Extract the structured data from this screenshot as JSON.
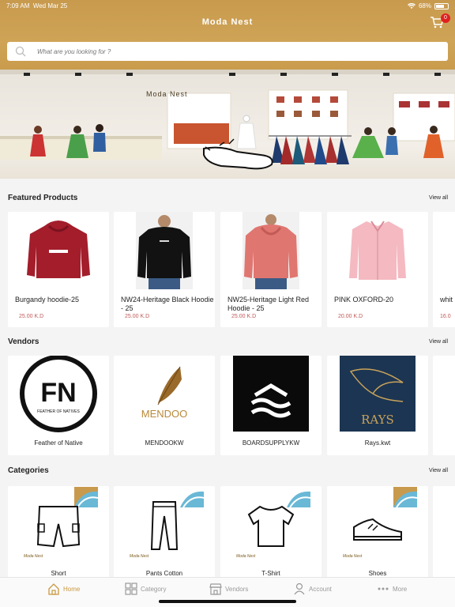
{
  "status_bar": {
    "time": "7:09 AM",
    "date": "Wed Mar 25",
    "battery": "68%",
    "battery_level": 0.68
  },
  "header": {
    "title": "Moda Nest",
    "cart_count": "0"
  },
  "search": {
    "placeholder": "What are you looking for ?"
  },
  "banner": {
    "brand": "Moda Nest"
  },
  "featured": {
    "title": "Featured Products",
    "view_all": "View all",
    "items": [
      {
        "name": "Burgandy hoodie-25",
        "price": "25.00 K.D",
        "image": "burgundy-hoodie"
      },
      {
        "name": "NW24-Heritage Black Hoodie - 25",
        "price": "25.00 K.D",
        "image": "black-hoodie"
      },
      {
        "name": "NW25-Heritage Light Red Hoodie - 25",
        "price": "25.00 K.D",
        "image": "red-hoodie"
      },
      {
        "name": "PINK OXFORD-20",
        "price": "20.00 K.D",
        "image": "pink-shirt"
      },
      {
        "name": "whit",
        "price": "16.0",
        "image": "white-shirt"
      }
    ]
  },
  "vendors": {
    "title": "Vendors",
    "view_all": "View all",
    "items": [
      {
        "name": "Feather of Native",
        "logo_text": "FN",
        "logo_sub": "FEATHER OF NATIVES"
      },
      {
        "name": "MENDOOKW",
        "logo_text": "MENDOO"
      },
      {
        "name": "BOARDSUPPLYKW",
        "logo_text": ""
      },
      {
        "name": "Rays.kwt",
        "logo_text": "RAYS"
      }
    ]
  },
  "categories": {
    "title": "Categories",
    "view_all": "View all",
    "brand_mark": "Moda Nest",
    "items": [
      {
        "name": "Short",
        "icon": "shorts-icon"
      },
      {
        "name": "Pants Cotton",
        "icon": "pants-icon"
      },
      {
        "name": "T-Shirt",
        "icon": "tshirt-icon"
      },
      {
        "name": "Shoes",
        "icon": "shoe-icon"
      }
    ]
  },
  "tabbar": {
    "items": [
      {
        "label": "Home",
        "icon": "home-icon",
        "active": true
      },
      {
        "label": "Category",
        "icon": "grid-icon",
        "active": false
      },
      {
        "label": "Vendors",
        "icon": "store-icon",
        "active": false
      },
      {
        "label": "Account",
        "icon": "user-icon",
        "active": false
      },
      {
        "label": "More",
        "icon": "more-icon",
        "active": false
      }
    ]
  },
  "colors": {
    "accent": "#c9973f",
    "price": "#c15a5a",
    "badge": "#e02020"
  }
}
